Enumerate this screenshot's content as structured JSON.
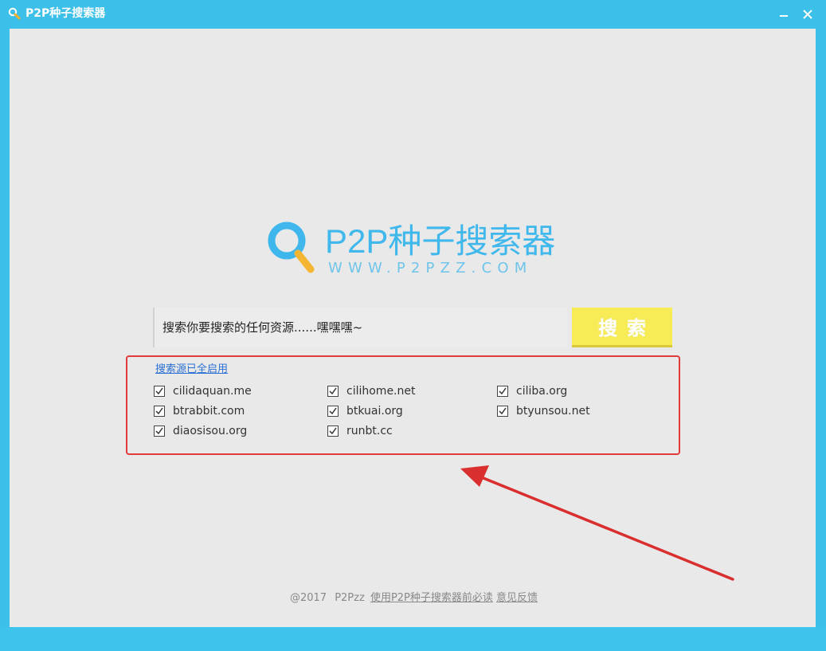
{
  "window": {
    "title": "P2P种子搜索器",
    "minimize_label": "—",
    "close_label": "✕"
  },
  "logo": {
    "title": "P2P种子搜索器",
    "url": "WWW.P2PZZ.COM"
  },
  "search": {
    "placeholder": "搜索你要搜索的任何资源......嘿嘿嘿~",
    "button_label": "搜索"
  },
  "sources": {
    "status_link": "搜索源已全启用",
    "items": [
      {
        "label": "cilidaquan.me",
        "checked": true
      },
      {
        "label": "cilihome.net",
        "checked": true
      },
      {
        "label": "ciliba.org",
        "checked": true
      },
      {
        "label": "btrabbit.com",
        "checked": true
      },
      {
        "label": "btkuai.org",
        "checked": true
      },
      {
        "label": "btyunsou.net",
        "checked": true
      },
      {
        "label": "diaosisou.org",
        "checked": true
      },
      {
        "label": "runbt.cc",
        "checked": true
      }
    ]
  },
  "footer": {
    "copyright": "@2017",
    "brand": "P2Pzz",
    "guide_link": "使用P2P种子搜索器前必读",
    "feedback_link": "意见反馈"
  },
  "colors": {
    "frame": "#3cbfe8",
    "content_bg": "#e9e9e9",
    "logo": "#40b8ec",
    "search_button": "#f7ec55",
    "highlight": "#e03a3a",
    "link": "#2a6fd6"
  }
}
